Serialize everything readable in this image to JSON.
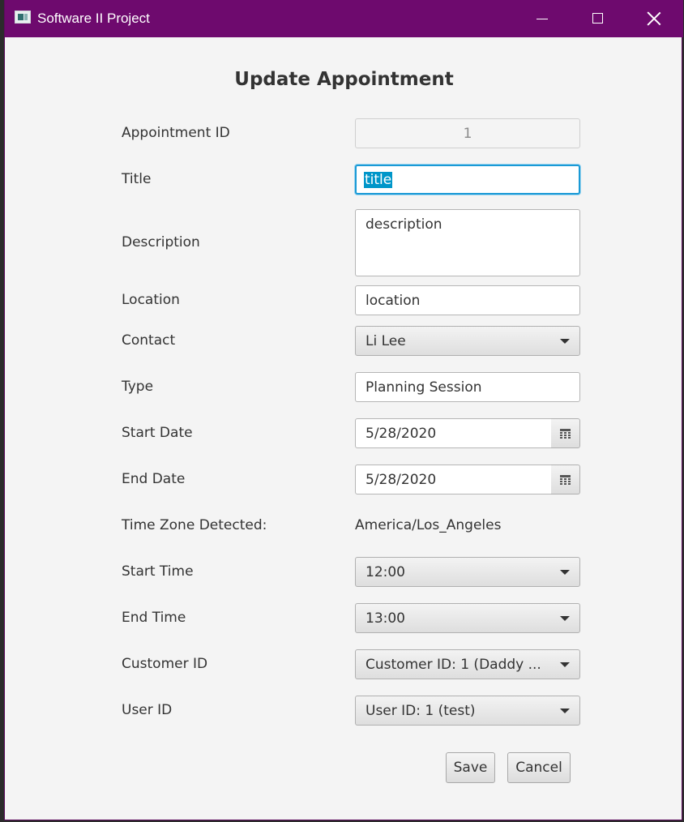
{
  "window": {
    "title": "Software II Project"
  },
  "form": {
    "heading": "Update Appointment",
    "appointment_id": {
      "label": "Appointment ID",
      "value": "1"
    },
    "title": {
      "label": "Title",
      "value": "title"
    },
    "description": {
      "label": "Description",
      "value": "description"
    },
    "location": {
      "label": "Location",
      "value": "location"
    },
    "contact": {
      "label": "Contact",
      "value": "Li Lee"
    },
    "type": {
      "label": "Type",
      "value": "Planning Session"
    },
    "start_date": {
      "label": "Start Date",
      "value": "5/28/2020"
    },
    "end_date": {
      "label": "End Date",
      "value": "5/28/2020"
    },
    "time_zone": {
      "label": "Time Zone Detected:",
      "value": "America/Los_Angeles"
    },
    "start_time": {
      "label": "Start Time",
      "value": "12:00"
    },
    "end_time": {
      "label": "End Time",
      "value": "13:00"
    },
    "customer_id": {
      "label": "Customer ID",
      "value": "Customer ID: 1 (Daddy ..."
    },
    "user_id": {
      "label": "User ID",
      "value": "User ID: 1 (test)"
    }
  },
  "buttons": {
    "save": "Save",
    "cancel": "Cancel"
  },
  "colors": {
    "titlebar": "#6e0a6e",
    "focus": "#1a9ad6",
    "selection": "#0096c9",
    "background": "#f4f4f4"
  },
  "icons": [
    "app-icon",
    "minimize-icon",
    "maximize-icon",
    "close-icon",
    "calendar-icon",
    "chevron-down-icon"
  ]
}
